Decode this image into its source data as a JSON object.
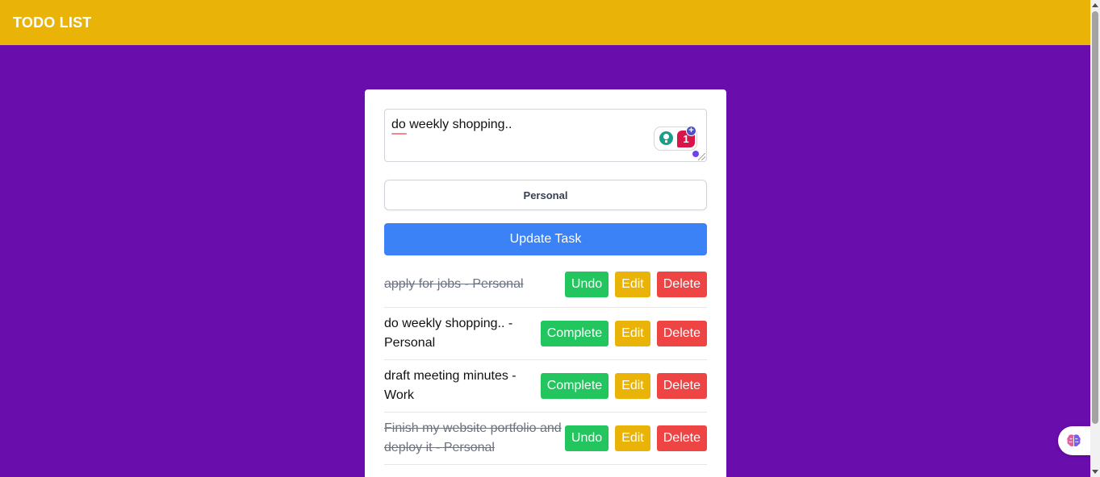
{
  "header": {
    "title": "TODO LIST"
  },
  "form": {
    "task_value": "do weekly shopping..",
    "grammar_issue_count": "1",
    "grammar_plus": "+",
    "category_selected": "Personal",
    "submit_label": "Update Task"
  },
  "tasks": [
    {
      "text": "apply for jobs - Personal",
      "completed": true,
      "toggle_label": "Undo",
      "edit_label": "Edit",
      "delete_label": "Delete"
    },
    {
      "text": "do weekly shopping.. - Personal",
      "completed": false,
      "toggle_label": "Complete",
      "edit_label": "Edit",
      "delete_label": "Delete"
    },
    {
      "text": "draft meeting minutes - Work",
      "completed": false,
      "toggle_label": "Complete",
      "edit_label": "Edit",
      "delete_label": "Delete"
    },
    {
      "text": "Finish my website portfolio and deploy it - Personal",
      "completed": true,
      "toggle_label": "Undo",
      "edit_label": "Edit",
      "delete_label": "Delete"
    }
  ],
  "colors": {
    "header_bg": "#e9b308",
    "page_bg": "#6a0dad",
    "primary": "#3b82f6",
    "success": "#22c55e",
    "warning": "#e9b308",
    "danger": "#ef4444"
  },
  "icons": {
    "grammar_suggestion": "lightbulb-icon",
    "assistant": "brain-icon",
    "resize": "resize-grip-icon"
  }
}
